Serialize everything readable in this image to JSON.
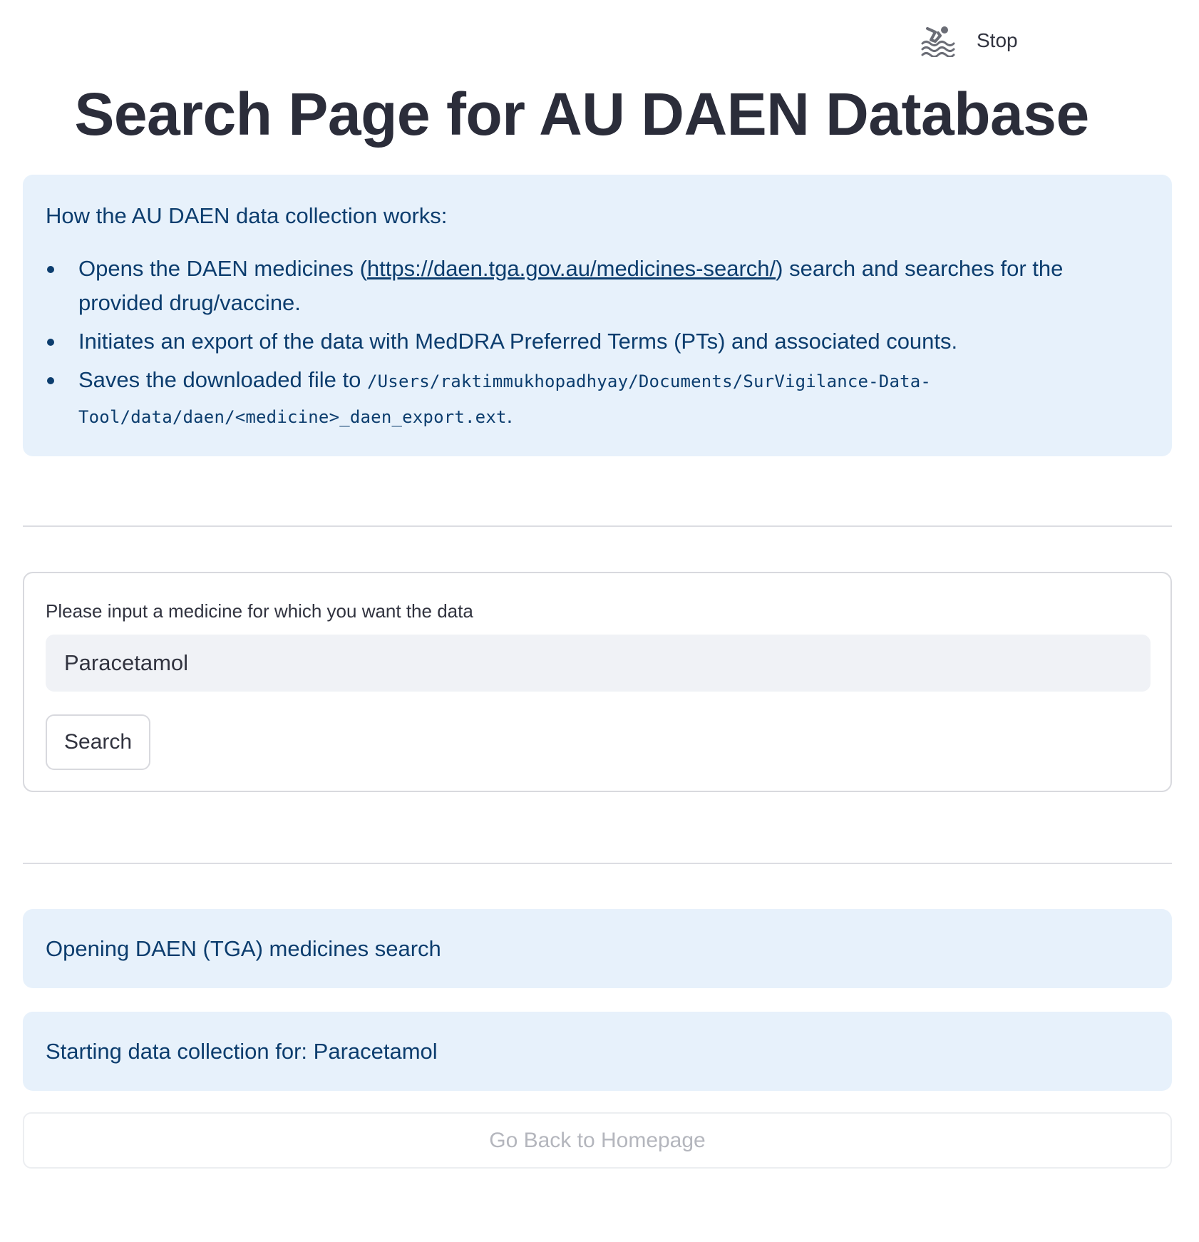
{
  "header": {
    "status_icon": "swimmer-icon",
    "stop_label": "Stop"
  },
  "title": "Search Page for AU DAEN Database",
  "info": {
    "heading": "How the AU DAEN data collection works:",
    "item1_prefix": "Opens the DAEN medicines (",
    "item1_link": "https://daen.tga.gov.au/medicines-search/",
    "item1_suffix": ") search and searches for the provided drug/vaccine.",
    "item2": "Initiates an export of the data with MedDRA Preferred Terms (PTs) and associated counts.",
    "item3_prefix": "Saves the downloaded file to ",
    "item3_path": "/Users/raktimmukhopadhyay/Documents/SurVigilance-Data-Tool/data/daen/<medicine>_daen_export.ext",
    "item3_suffix": "."
  },
  "form": {
    "label": "Please input a medicine for which you want the data",
    "input_value": "Paracetamol",
    "search_label": "Search"
  },
  "messages": {
    "opening": "Opening DAEN (TGA) medicines search",
    "starting": "Starting data collection for: Paracetamol"
  },
  "home_button": "Go Back to Homepage",
  "colors": {
    "info_bg": "#e7f1fb",
    "info_text": "#0c3d6e",
    "title_text": "#2b2d3a",
    "input_bg": "#f0f2f6"
  }
}
